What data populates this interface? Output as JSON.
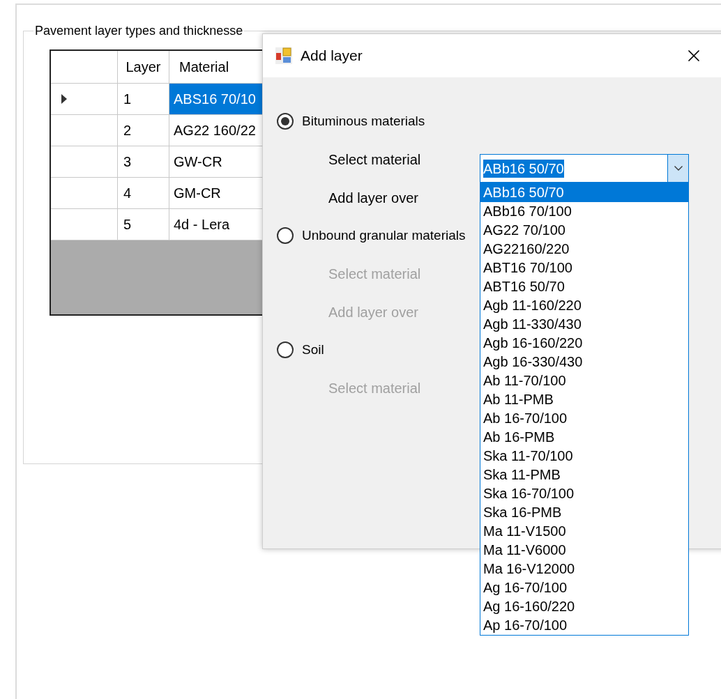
{
  "group_box": {
    "title": "Pavement layer types and thicknesse"
  },
  "grid": {
    "columns": [
      "Layer",
      "Material"
    ],
    "rows": [
      {
        "layer": "1",
        "material": "ABS16 70/10",
        "selected": true
      },
      {
        "layer": "2",
        "material": "AG22 160/22",
        "selected": false
      },
      {
        "layer": "3",
        "material": "GW-CR",
        "selected": false
      },
      {
        "layer": "4",
        "material": "GM-CR",
        "selected": false
      },
      {
        "layer": "5",
        "material": "4d - Lera",
        "selected": false
      }
    ]
  },
  "dialog": {
    "title": "Add layer",
    "sections": [
      {
        "label": "Bituminous materials",
        "selected": true,
        "fields": [
          {
            "label": "Select material",
            "disabled": false
          },
          {
            "label": "Add layer over",
            "disabled": false
          }
        ]
      },
      {
        "label": "Unbound granular materials",
        "selected": false,
        "fields": [
          {
            "label": "Select material",
            "disabled": true
          },
          {
            "label": "Add layer over",
            "disabled": true
          }
        ]
      },
      {
        "label": "Soil",
        "selected": false,
        "fields": [
          {
            "label": "Select material",
            "disabled": true
          }
        ]
      }
    ],
    "combo": {
      "value": "ABb16 50/70"
    },
    "dropdown": {
      "items": [
        {
          "label": "ABb16 50/70",
          "selected": true
        },
        {
          "label": "ABb16 70/100",
          "selected": false
        },
        {
          "label": "AG22 70/100",
          "selected": false
        },
        {
          "label": "AG22160/220",
          "selected": false
        },
        {
          "label": "ABT16 70/100",
          "selected": false
        },
        {
          "label": "ABT16 50/70",
          "selected": false
        },
        {
          "label": "Agb 11-160/220",
          "selected": false
        },
        {
          "label": "Agb 11-330/430",
          "selected": false
        },
        {
          "label": "Agb 16-160/220",
          "selected": false
        },
        {
          "label": "Agb 16-330/430",
          "selected": false
        },
        {
          "label": "Ab 11-70/100",
          "selected": false
        },
        {
          "label": "Ab 11-PMB",
          "selected": false
        },
        {
          "label": "Ab 16-70/100",
          "selected": false
        },
        {
          "label": "Ab 16-PMB",
          "selected": false
        },
        {
          "label": "Ska 11-70/100",
          "selected": false
        },
        {
          "label": "Ska 11-PMB",
          "selected": false
        },
        {
          "label": "Ska 16-70/100",
          "selected": false
        },
        {
          "label": "Ska 16-PMB",
          "selected": false
        },
        {
          "label": "Ma 11-V1500",
          "selected": false
        },
        {
          "label": "Ma 11-V6000",
          "selected": false
        },
        {
          "label": "Ma 16-V12000",
          "selected": false
        },
        {
          "label": "Ag 16-70/100",
          "selected": false
        },
        {
          "label": "Ag 16-160/220",
          "selected": false
        },
        {
          "label": "Ap 16-70/100",
          "selected": false
        }
      ]
    }
  }
}
